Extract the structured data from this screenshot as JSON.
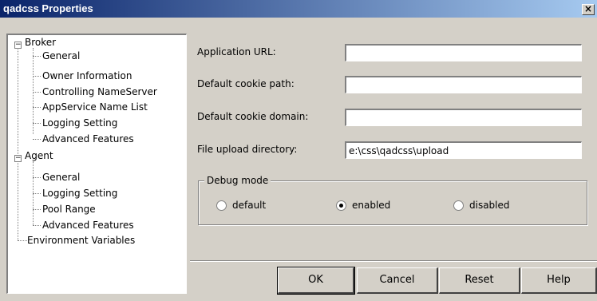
{
  "window": {
    "title": "qadcss Properties",
    "close_glyph": "×"
  },
  "tree": {
    "broker": {
      "label": "Broker",
      "expander": "−",
      "children": [
        "General",
        "Owner Information",
        "Controlling NameServer",
        "AppService Name List",
        "Logging Setting",
        "Advanced Features"
      ]
    },
    "agent": {
      "label": "Agent",
      "expander": "−",
      "children": [
        "General",
        "Logging Setting",
        "Pool Range",
        "Advanced Features"
      ]
    },
    "env": {
      "label": "Environment Variables"
    }
  },
  "form": {
    "app_url": {
      "label": "Application URL:",
      "value": ""
    },
    "cookie_path": {
      "label": "Default cookie path:",
      "value": ""
    },
    "cookie_domain": {
      "label": "Default cookie domain:",
      "value": ""
    },
    "upload_dir": {
      "label": "File upload directory:",
      "value": "e:\\css\\qadcss\\upload"
    }
  },
  "debug": {
    "label": "Debug mode",
    "options": [
      "default",
      "enabled",
      "disabled"
    ],
    "selected": "enabled"
  },
  "buttons": {
    "ok": "OK",
    "cancel": "Cancel",
    "reset": "Reset",
    "help": "Help"
  }
}
